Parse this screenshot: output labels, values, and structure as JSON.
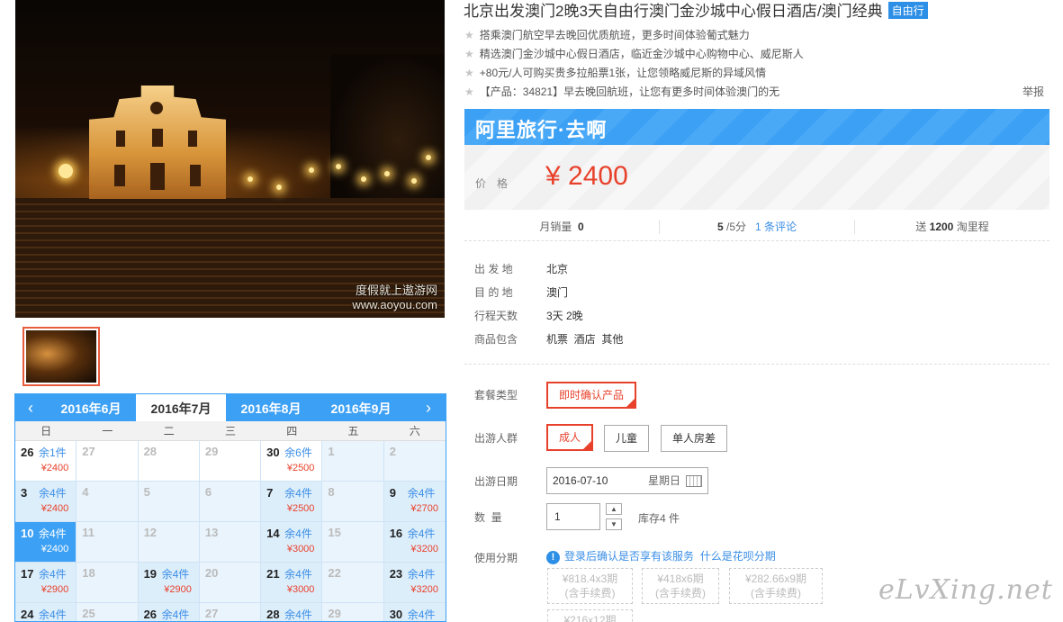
{
  "product": {
    "title": "北京出发澳门2晚3天自由行澳门金沙城中心假日酒店/澳门经典",
    "tag": "自由行",
    "highlights": [
      "搭乘澳门航空早去晚回优质航班，更多时间体验葡式魅力",
      "精选澳门金沙城中心假日酒店，临近金沙城中心购物中心、威尼斯人",
      "+80元/人可购买贵多拉船票1张，让您领略威尼斯的异域风情",
      "【产品：34821】早去晚回航班，让您有更多时间体验澳门的无"
    ],
    "report": "举报"
  },
  "image": {
    "watermark_line1": "度假就上遨游网",
    "watermark_line2": "www.aoyou.com"
  },
  "brand": {
    "text": "阿里旅行·去啊"
  },
  "price": {
    "label": "价格",
    "value": "¥ 2400"
  },
  "stats": {
    "monthly_label": "月销量",
    "monthly_value": "0",
    "rating_value": "5",
    "rating_suffix": "/5分",
    "reviews_link": "1 条评论",
    "points_prefix": "送",
    "points_value": "1200",
    "points_suffix": "淘里程"
  },
  "info": [
    {
      "k": "出 发 地",
      "v": "北京"
    },
    {
      "k": "目 的 地",
      "v": "澳门"
    },
    {
      "k": "行程天数",
      "v": "3天 2晚"
    },
    {
      "k": "商品包含",
      "v": "机票  酒店  其他"
    }
  ],
  "booking": {
    "package_label": "套餐类型",
    "package_options": [
      "即时确认产品"
    ],
    "traveler_label": "出游人群",
    "traveler_options": [
      "成人",
      "儿童",
      "单人房差"
    ],
    "date_label": "出游日期",
    "date_value": "2016-07-10",
    "date_weekday": "星期日",
    "qty_label": "数  量",
    "qty_value": "1",
    "stock": "库存4 件",
    "installment_label": "使用分期",
    "installment_info": "登录后确认是否享有该服务",
    "installment_link": "什么是花呗分期",
    "installments": [
      {
        "line1": "¥818.4x3期",
        "line2": "(含手续费)"
      },
      {
        "line1": "¥418x6期",
        "line2": "(含手续费)"
      },
      {
        "line1": "¥282.66x9期",
        "line2": "(含手续费)"
      },
      {
        "line1": "¥216x12期",
        "line2": ""
      }
    ]
  },
  "calendar": {
    "prev_arrow": "‹",
    "next_arrow": "›",
    "months": [
      "2016年6月",
      "2016年7月",
      "2016年8月",
      "2016年9月"
    ],
    "active_month": 1,
    "weekdays": [
      "日",
      "一",
      "二",
      "三",
      "四",
      "五",
      "六"
    ],
    "days": [
      {
        "d": "26",
        "s": "余1件",
        "p": "¥2400",
        "t": "wh"
      },
      {
        "d": "27",
        "s": "",
        "p": "",
        "t": "wh dis"
      },
      {
        "d": "28",
        "s": "",
        "p": "",
        "t": "wh dis"
      },
      {
        "d": "29",
        "s": "",
        "p": "",
        "t": "wh dis"
      },
      {
        "d": "30",
        "s": "余6件",
        "p": "¥2500",
        "t": "wh"
      },
      {
        "d": "1",
        "s": "",
        "p": "",
        "t": "dis"
      },
      {
        "d": "2",
        "s": "",
        "p": "",
        "t": "dis"
      },
      {
        "d": "3",
        "s": "余4件",
        "p": "¥2400",
        "t": "avail"
      },
      {
        "d": "4",
        "s": "",
        "p": "",
        "t": "dis"
      },
      {
        "d": "5",
        "s": "",
        "p": "",
        "t": "dis"
      },
      {
        "d": "6",
        "s": "",
        "p": "",
        "t": "dis"
      },
      {
        "d": "7",
        "s": "余4件",
        "p": "¥2500",
        "t": "avail"
      },
      {
        "d": "8",
        "s": "",
        "p": "",
        "t": "dis"
      },
      {
        "d": "9",
        "s": "余4件",
        "p": "¥2700",
        "t": "avail"
      },
      {
        "d": "10",
        "s": "余4件",
        "p": "¥2400",
        "t": "sel"
      },
      {
        "d": "11",
        "s": "",
        "p": "",
        "t": "dis"
      },
      {
        "d": "12",
        "s": "",
        "p": "",
        "t": "dis"
      },
      {
        "d": "13",
        "s": "",
        "p": "",
        "t": "dis"
      },
      {
        "d": "14",
        "s": "余4件",
        "p": "¥3000",
        "t": "avail"
      },
      {
        "d": "15",
        "s": "",
        "p": "",
        "t": "dis"
      },
      {
        "d": "16",
        "s": "余4件",
        "p": "¥3200",
        "t": "avail"
      },
      {
        "d": "17",
        "s": "余4件",
        "p": "¥2900",
        "t": "avail"
      },
      {
        "d": "18",
        "s": "",
        "p": "",
        "t": "dis"
      },
      {
        "d": "19",
        "s": "余4件",
        "p": "¥2900",
        "t": "avail"
      },
      {
        "d": "20",
        "s": "",
        "p": "",
        "t": "dis"
      },
      {
        "d": "21",
        "s": "余4件",
        "p": "¥3000",
        "t": "avail"
      },
      {
        "d": "22",
        "s": "",
        "p": "",
        "t": "dis"
      },
      {
        "d": "23",
        "s": "余4件",
        "p": "¥3200",
        "t": "avail"
      },
      {
        "d": "24",
        "s": "余4件",
        "p": "",
        "t": "avail"
      },
      {
        "d": "25",
        "s": "",
        "p": "",
        "t": "dis"
      },
      {
        "d": "26",
        "s": "余4件",
        "p": "",
        "t": "avail"
      },
      {
        "d": "27",
        "s": "",
        "p": "",
        "t": "dis"
      },
      {
        "d": "28",
        "s": "余4件",
        "p": "",
        "t": "avail"
      },
      {
        "d": "29",
        "s": "",
        "p": "",
        "t": "dis"
      },
      {
        "d": "30",
        "s": "余4件",
        "p": "",
        "t": "avail"
      }
    ]
  },
  "site_logo": "eLvXing.net",
  "colors": {
    "accent": "#3ca0f5",
    "price": "#e8412b",
    "link": "#3a8ee6"
  }
}
